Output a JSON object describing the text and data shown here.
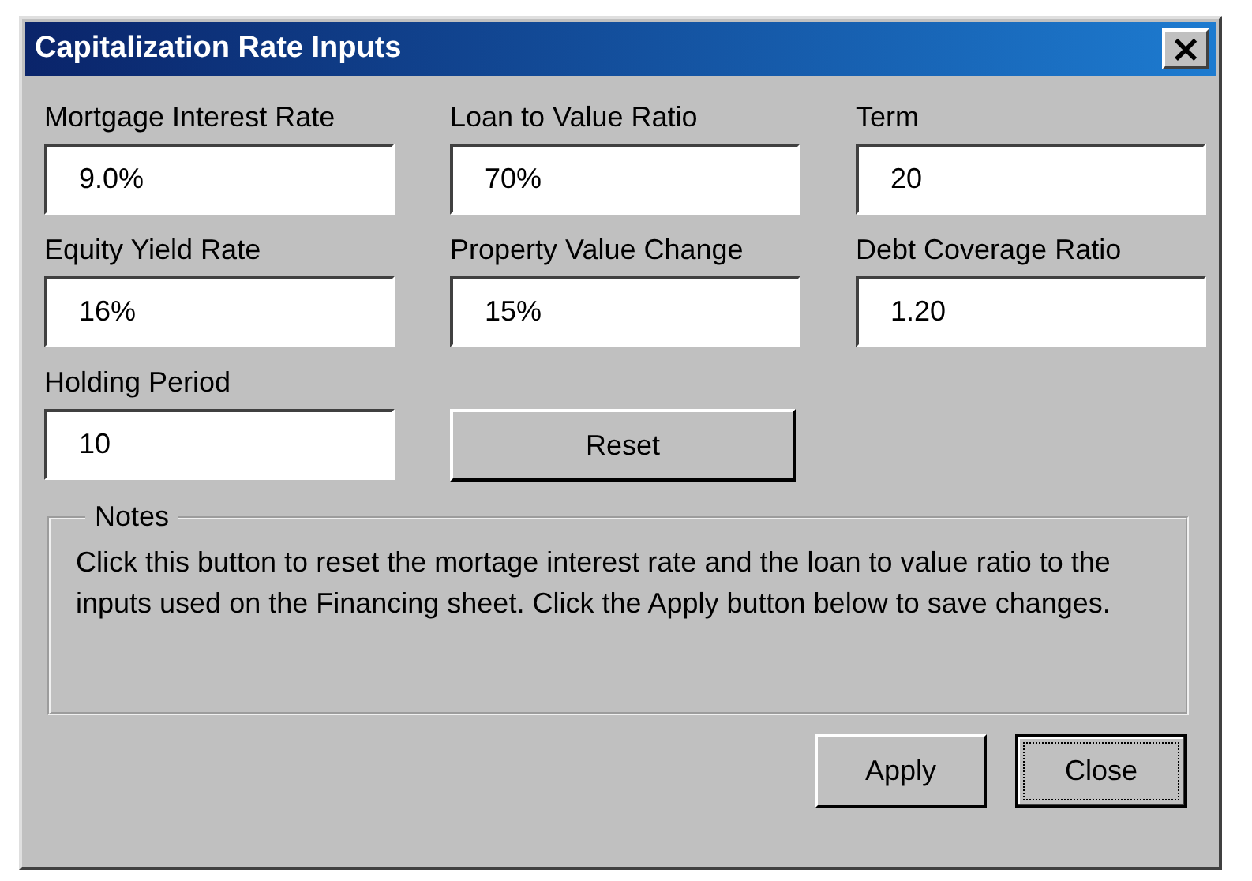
{
  "window": {
    "title": "Capitalization Rate Inputs",
    "close_glyph": "×"
  },
  "fields": [
    {
      "label": "Mortgage Interest Rate",
      "value": "9.0%"
    },
    {
      "label": "Loan to Value Ratio",
      "value": "70%"
    },
    {
      "label": "Term",
      "value": "20"
    },
    {
      "label": "Equity Yield Rate",
      "value": "16%"
    },
    {
      "label": "Property Value Change",
      "value": "15%"
    },
    {
      "label": "Debt Coverage Ratio",
      "value": "1.20"
    },
    {
      "label": "Holding Period",
      "value": "10"
    }
  ],
  "reset_button": "Reset",
  "notes": {
    "title": "Notes",
    "text": "Click this button to reset the mortage interest rate and the loan to value ratio to the inputs used on the Financing sheet. Click the Apply button below to save changes."
  },
  "buttons": [
    {
      "label": "Apply",
      "focused": false
    },
    {
      "label": "Close",
      "focused": true
    }
  ]
}
